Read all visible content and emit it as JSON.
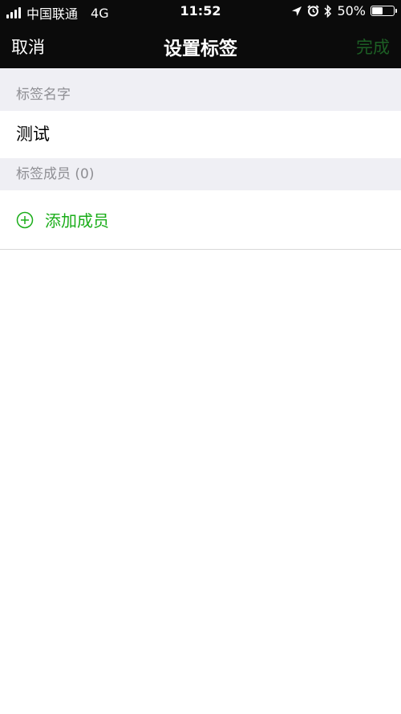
{
  "status_bar": {
    "carrier": "中国联通",
    "network": "4G",
    "time": "11:52",
    "battery_text": "50%",
    "battery_level": 0.5
  },
  "nav": {
    "cancel_label": "取消",
    "title": "设置标签",
    "done_label": "完成"
  },
  "sections": {
    "name_header": "标签名字",
    "name_value": "测试",
    "members_header": "标签成员 (0)",
    "add_member_label": "添加成员"
  },
  "colors": {
    "topbar_bg": "#0b0b0b",
    "done_disabled": "#1c5e24",
    "accent_green": "#1aad19",
    "section_bg": "#efeff4",
    "section_text": "#8e8e93"
  },
  "icons": {
    "signal": "signal-bars-icon",
    "location": "location-arrow-icon",
    "alarm": "alarm-clock-icon",
    "bluetooth": "bluetooth-icon",
    "battery": "battery-icon",
    "add": "plus-circle-icon"
  }
}
